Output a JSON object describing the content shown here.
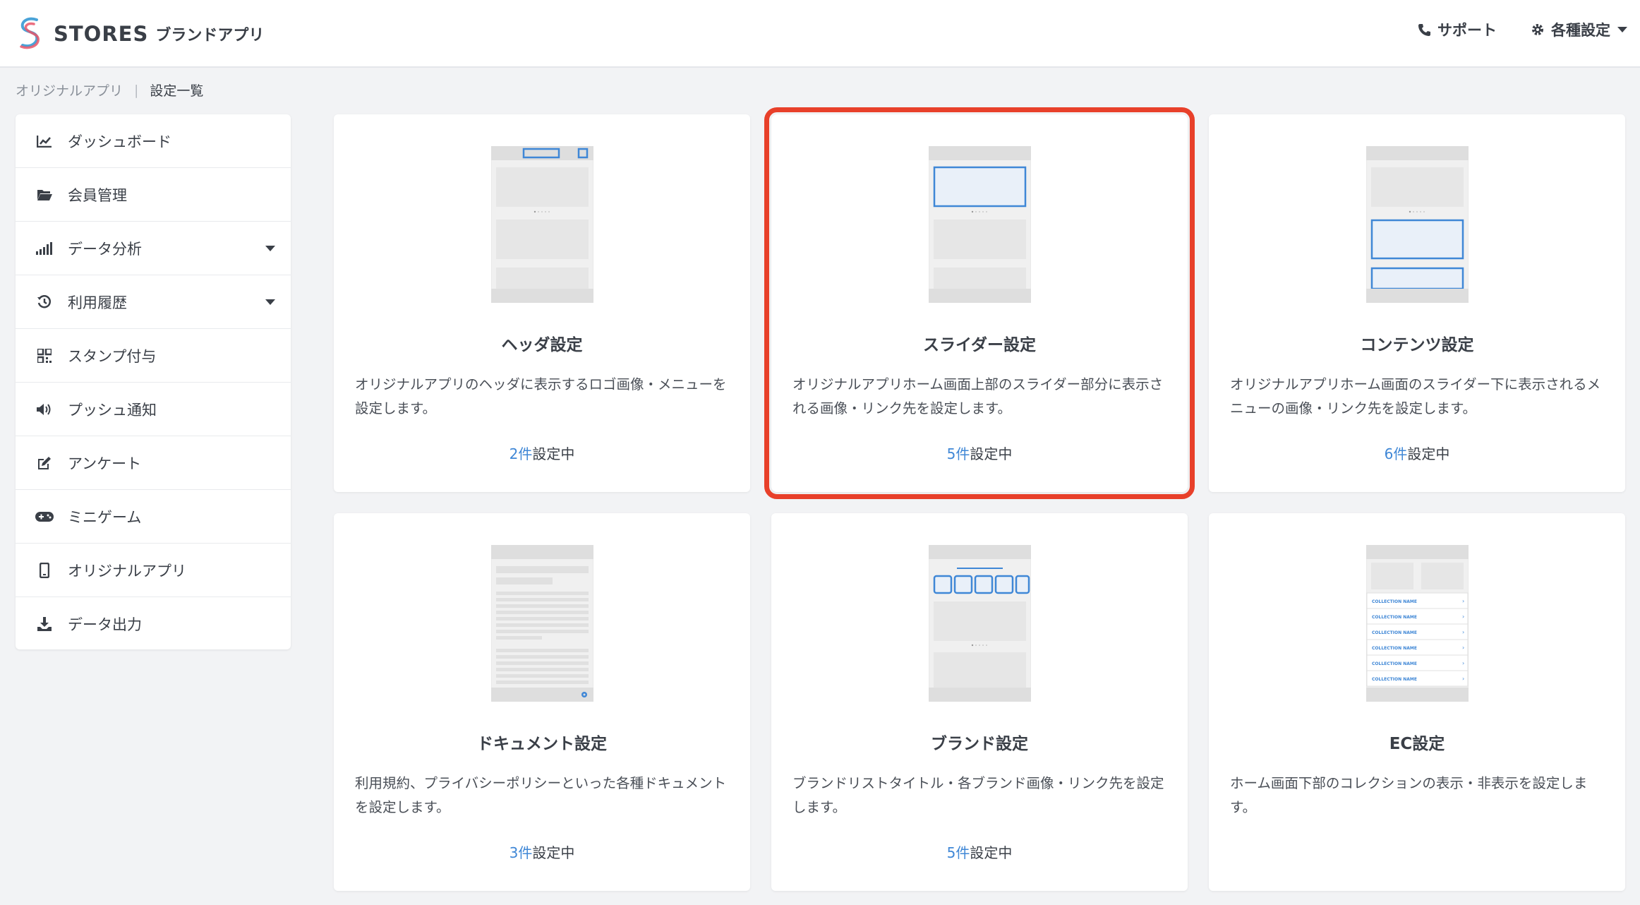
{
  "app": {
    "brand": "STORES",
    "brand_sub": "ブランドアプリ"
  },
  "topnav": {
    "support_label": "サポート",
    "settings_label": "各種設定"
  },
  "breadcrumb": {
    "parent": "オリジナルアプリ",
    "separator": "|",
    "current": "設定一覧"
  },
  "sidebar": {
    "items": [
      {
        "label": "ダッシュボード",
        "icon": "chart-line-icon"
      },
      {
        "label": "会員管理",
        "icon": "folder-open-icon"
      },
      {
        "label": "データ分析",
        "icon": "signal-bars-icon",
        "expandable": true
      },
      {
        "label": "利用履歴",
        "icon": "history-icon",
        "expandable": true
      },
      {
        "label": "スタンプ付与",
        "icon": "qrcode-icon"
      },
      {
        "label": "プッシュ通知",
        "icon": "speaker-icon"
      },
      {
        "label": "アンケート",
        "icon": "edit-icon"
      },
      {
        "label": "ミニゲーム",
        "icon": "gamepad-icon"
      },
      {
        "label": "オリジナルアプリ",
        "icon": "mobile-icon"
      },
      {
        "label": "データ出力",
        "icon": "download-icon"
      }
    ]
  },
  "cards": [
    {
      "title": "ヘッダ設定",
      "desc": "オリジナルアプリのヘッダに表示するロゴ画像・メニューを設定します。",
      "count": "2件",
      "count_suffix": "設定中"
    },
    {
      "title": "スライダー設定",
      "desc": "オリジナルアプリホーム画面上部のスライダー部分に表示される画像・リンク先を設定します。",
      "count": "5件",
      "count_suffix": "設定中",
      "highlighted": true
    },
    {
      "title": "コンテンツ設定",
      "desc": "オリジナルアプリホーム画面のスライダー下に表示されるメニューの画像・リンク先を設定します。",
      "count": "6件",
      "count_suffix": "設定中"
    },
    {
      "title": "ドキュメント設定",
      "desc": "利用規約、プライバシーポリシーといった各種ドキュメントを設定します。",
      "count": "3件",
      "count_suffix": "設定中"
    },
    {
      "title": "ブランド設定",
      "desc": "ブランドリストタイトル・各ブランド画像・リンク先を設定します。",
      "count": "5件",
      "count_suffix": "設定中"
    },
    {
      "title": "EC設定",
      "desc": "ホーム画面下部のコレクションの表示・非表示を設定します。"
    }
  ],
  "ec_art": {
    "collection_label": "COLLECTION NAME"
  },
  "colors": {
    "accent_blue": "#3f87d6",
    "highlight_red": "#e8402a",
    "background": "#f2f3f5"
  }
}
